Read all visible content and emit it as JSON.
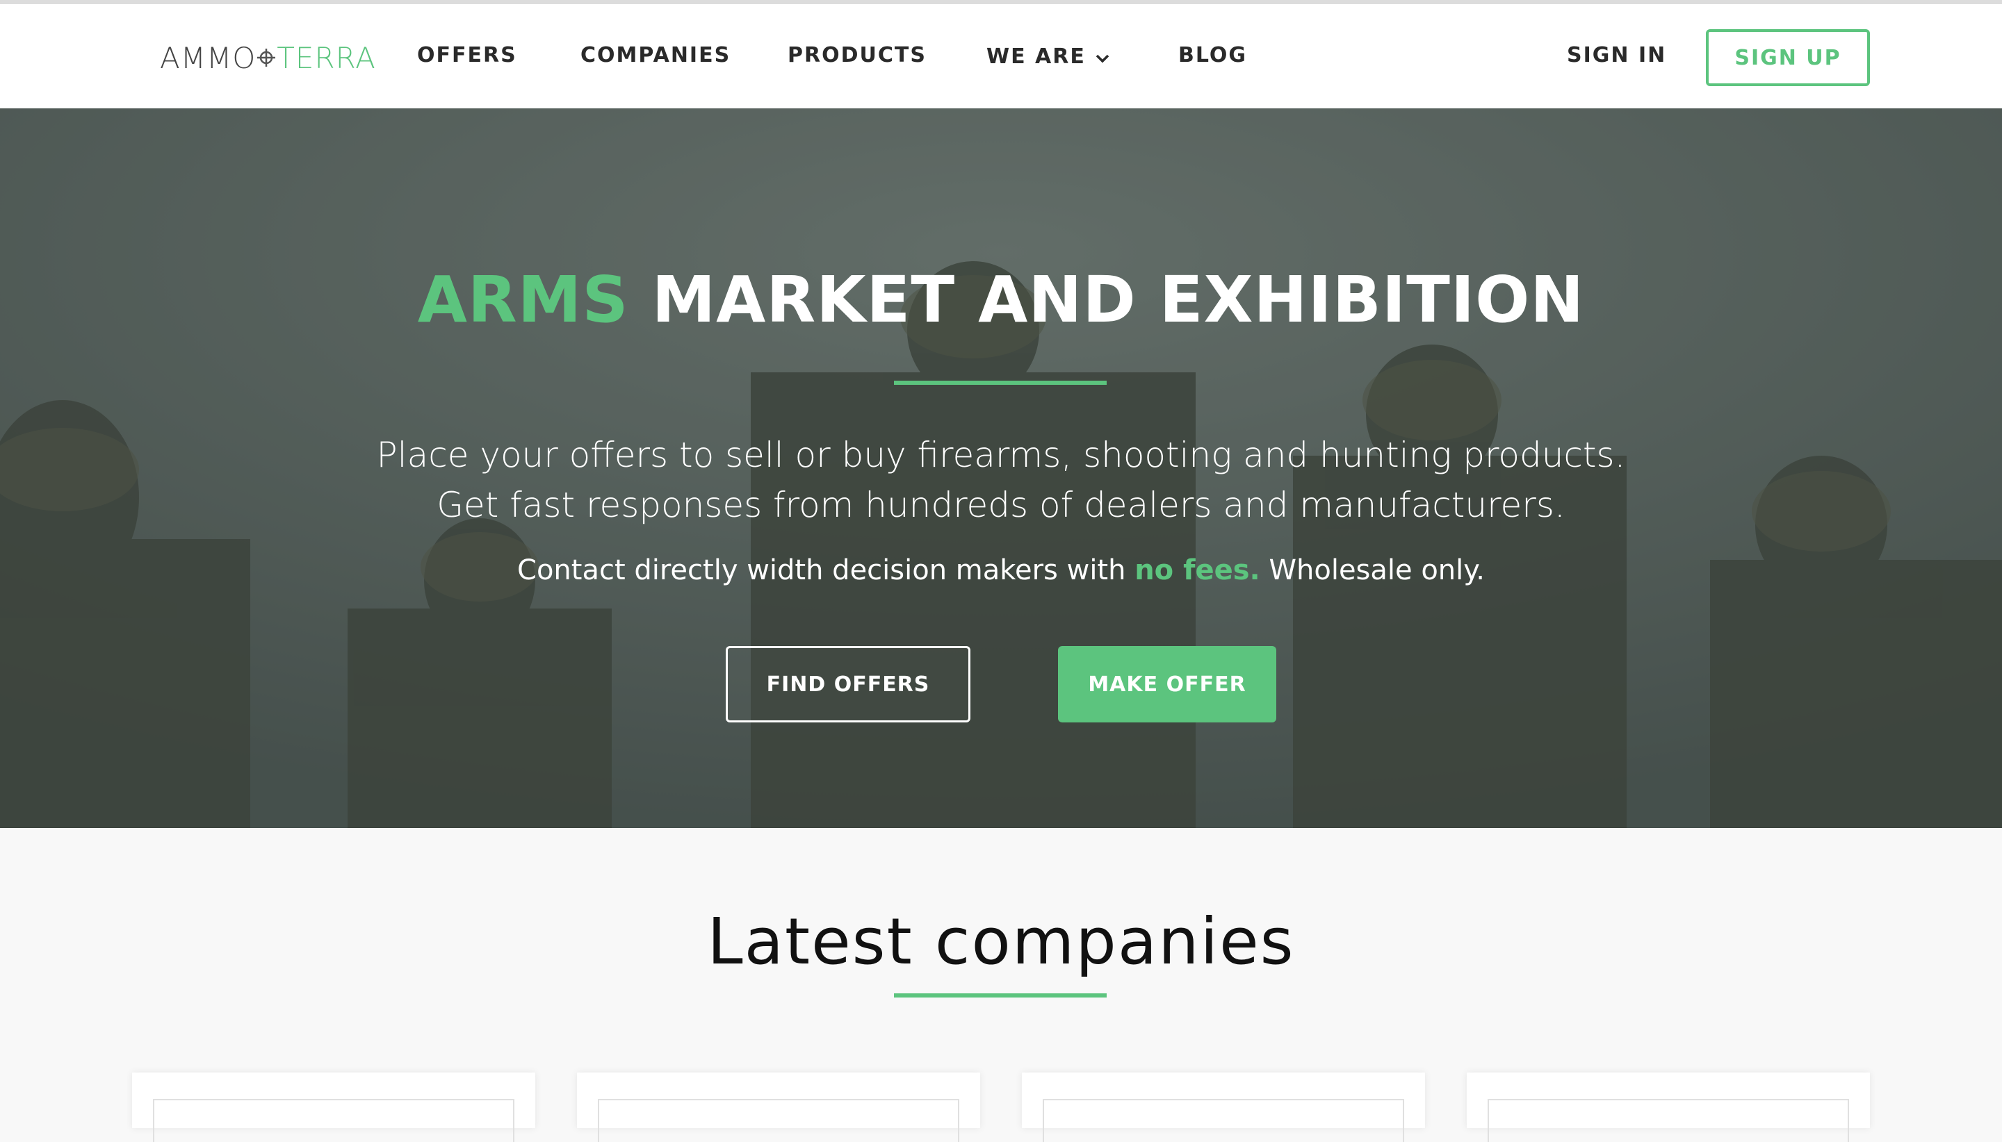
{
  "brand": {
    "logo_left": "AMMO",
    "logo_right": "TERRA",
    "accent_color": "#5cc47e"
  },
  "nav": {
    "items": [
      {
        "label": "OFFERS"
      },
      {
        "label": "COMPANIES"
      },
      {
        "label": "PRODUCTS"
      },
      {
        "label": "WE ARE"
      },
      {
        "label": "BLOG"
      }
    ],
    "sign_in": "SIGN IN",
    "sign_up": "SIGN UP"
  },
  "hero": {
    "title_accent": "ARMS",
    "title_rest": "MARKET AND EXHIBITION",
    "subtitle_line1": "Place your offers to sell or buy firearms, shooting and hunting products.",
    "subtitle_line2": "Get fast responses from hundreds of dealers and manufacturers.",
    "small_before": "Contact directly width decision makers with ",
    "small_highlight": "no fees.",
    "small_after": " Wholesale only.",
    "find_offers": "FIND OFFERS",
    "make_offer": "MAKE OFFER"
  },
  "latest": {
    "title": "Latest companies",
    "card_count": 4
  }
}
